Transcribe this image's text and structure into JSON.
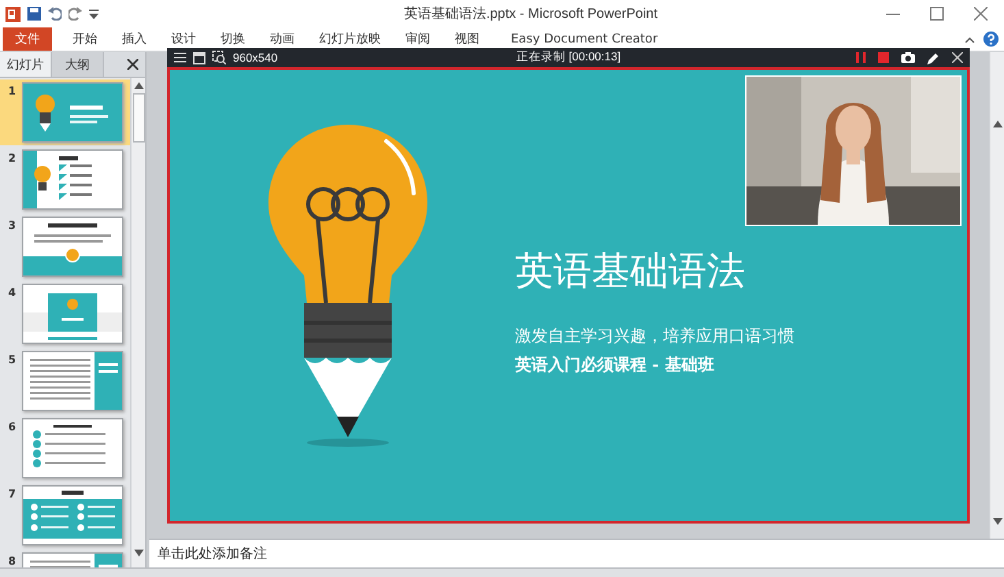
{
  "window": {
    "title": "英语基础语法.pptx - Microsoft PowerPoint"
  },
  "file_tab": {
    "label": "文件"
  },
  "ribbon_tabs": [
    "开始",
    "插入",
    "设计",
    "切换",
    "动画",
    "幻灯片放映",
    "审阅",
    "视图",
    "Easy Document Creator"
  ],
  "sidebar": {
    "tabs": [
      {
        "label": "幻灯片",
        "selected": true
      },
      {
        "label": "大纲",
        "selected": false
      }
    ]
  },
  "slides": [
    {
      "number": "1",
      "selected": true,
      "kind": "title"
    },
    {
      "number": "2",
      "selected": false,
      "kind": "list"
    },
    {
      "number": "3",
      "selected": false,
      "kind": "banner"
    },
    {
      "number": "4",
      "selected": false,
      "kind": "section"
    },
    {
      "number": "5",
      "selected": false,
      "kind": "text"
    },
    {
      "number": "6",
      "selected": false,
      "kind": "steps"
    },
    {
      "number": "7",
      "selected": false,
      "kind": "grid"
    },
    {
      "number": "8",
      "selected": false,
      "kind": "text"
    }
  ],
  "recorder": {
    "resolution": "960x540",
    "status": "正在录制 [00:00:13]"
  },
  "slide": {
    "title": "英语基础语法",
    "subtitle": "激发自主学习兴趣，培养应用口语习惯",
    "tagline": "英语入门必须课程  - 基础班"
  },
  "notes": {
    "prompt": "单击此处添加备注"
  }
}
